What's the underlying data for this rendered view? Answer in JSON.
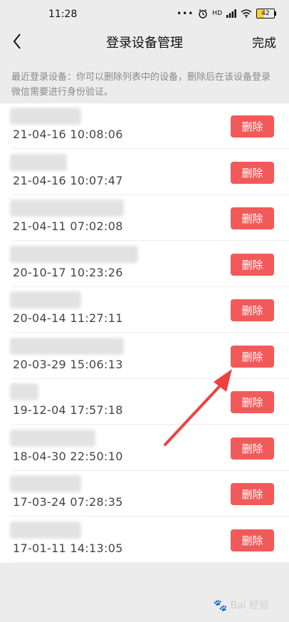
{
  "status_bar": {
    "time": "11:28",
    "dots": "•••",
    "alarm_icon": "alarm-icon",
    "network_label": "HD",
    "signal_icon": "signal-icon",
    "wifi_icon": "wifi-icon",
    "battery_level": "42",
    "battery_fraction": 0.42,
    "battery_color": "#f4d23c"
  },
  "nav": {
    "title": "登录设备管理",
    "done_label": "完成",
    "back_icon": "chevron-left-icon"
  },
  "hint": "最近登录设备：你可以删除列表中的设备，删除后在该设备登录微信需要进行身份验证。",
  "devices": [
    {
      "time": "21-04-16 10:08:06",
      "delete_label": "删除"
    },
    {
      "time": "21-04-16 10:07:47",
      "delete_label": "删除"
    },
    {
      "time": "21-04-11 07:02:08",
      "delete_label": "删除"
    },
    {
      "time": "20-10-17 10:23:26",
      "delete_label": "删除"
    },
    {
      "time": "20-04-14 11:27:11",
      "delete_label": "删除"
    },
    {
      "time": "20-03-29 15:06:13",
      "delete_label": "删除"
    },
    {
      "time": "19-12-04 17:57:18",
      "delete_label": "删除"
    },
    {
      "time": "18-04-30 22:50:10",
      "delete_label": "删除"
    },
    {
      "time": "17-03-24 07:28:35",
      "delete_label": "删除"
    },
    {
      "time": "17-01-11 14:13:05",
      "delete_label": "删除"
    }
  ],
  "colors": {
    "delete_button": "#f25a5a",
    "annotation_arrow": "#f04040",
    "background": "#ececec"
  },
  "watermark": {
    "text": "Bai 经验",
    "paw_icon": "baidu-paw-icon"
  }
}
